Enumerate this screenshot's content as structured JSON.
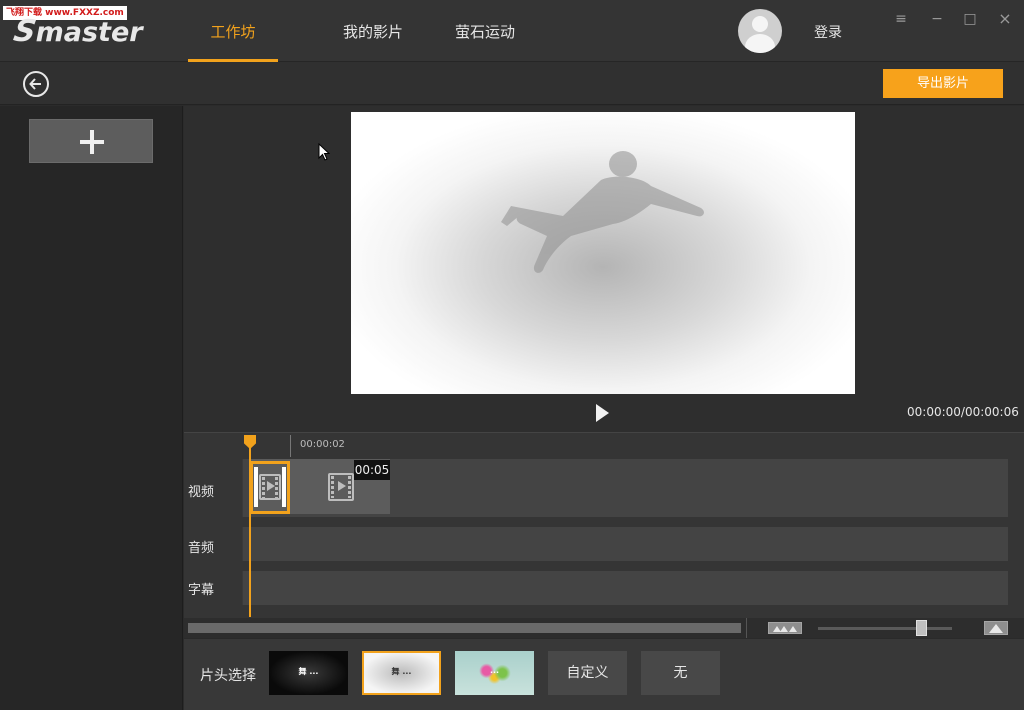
{
  "watermark": "飞翔下载 www.FXXZ.com",
  "app": {
    "logo_text": "master",
    "logo_mark": "S"
  },
  "nav": {
    "tabs": [
      {
        "label": "工作坊",
        "active": true
      },
      {
        "label": "我的影片",
        "active": false
      },
      {
        "label": "萤石运动",
        "active": false
      }
    ]
  },
  "account": {
    "login_label": "登录"
  },
  "window_controls": {
    "menu_icon": "≡",
    "minimize_icon": "−",
    "maximize_icon": "□",
    "close_icon": "×"
  },
  "toolbar": {
    "back_icon": "back-arrow-icon",
    "export_label": "导出影片"
  },
  "preview": {
    "time_readout": "00:00:00/00:00:06"
  },
  "timeline": {
    "ruler_time": "00:00:02",
    "tracks": [
      {
        "label": "视频"
      },
      {
        "label": "音频"
      },
      {
        "label": "字幕"
      }
    ],
    "clip_duration": "00:05"
  },
  "intro_selector": {
    "label": "片头选择",
    "thumb_dark_text": "舞 ...",
    "thumb_light_text": "舞 ...",
    "thumb_color_text": "...",
    "custom_label": "自定义",
    "none_label": "无",
    "selected_index": 1
  },
  "colors": {
    "accent": "#f2a21c",
    "export": "#f7a21b",
    "background": "#2b2b2b"
  }
}
